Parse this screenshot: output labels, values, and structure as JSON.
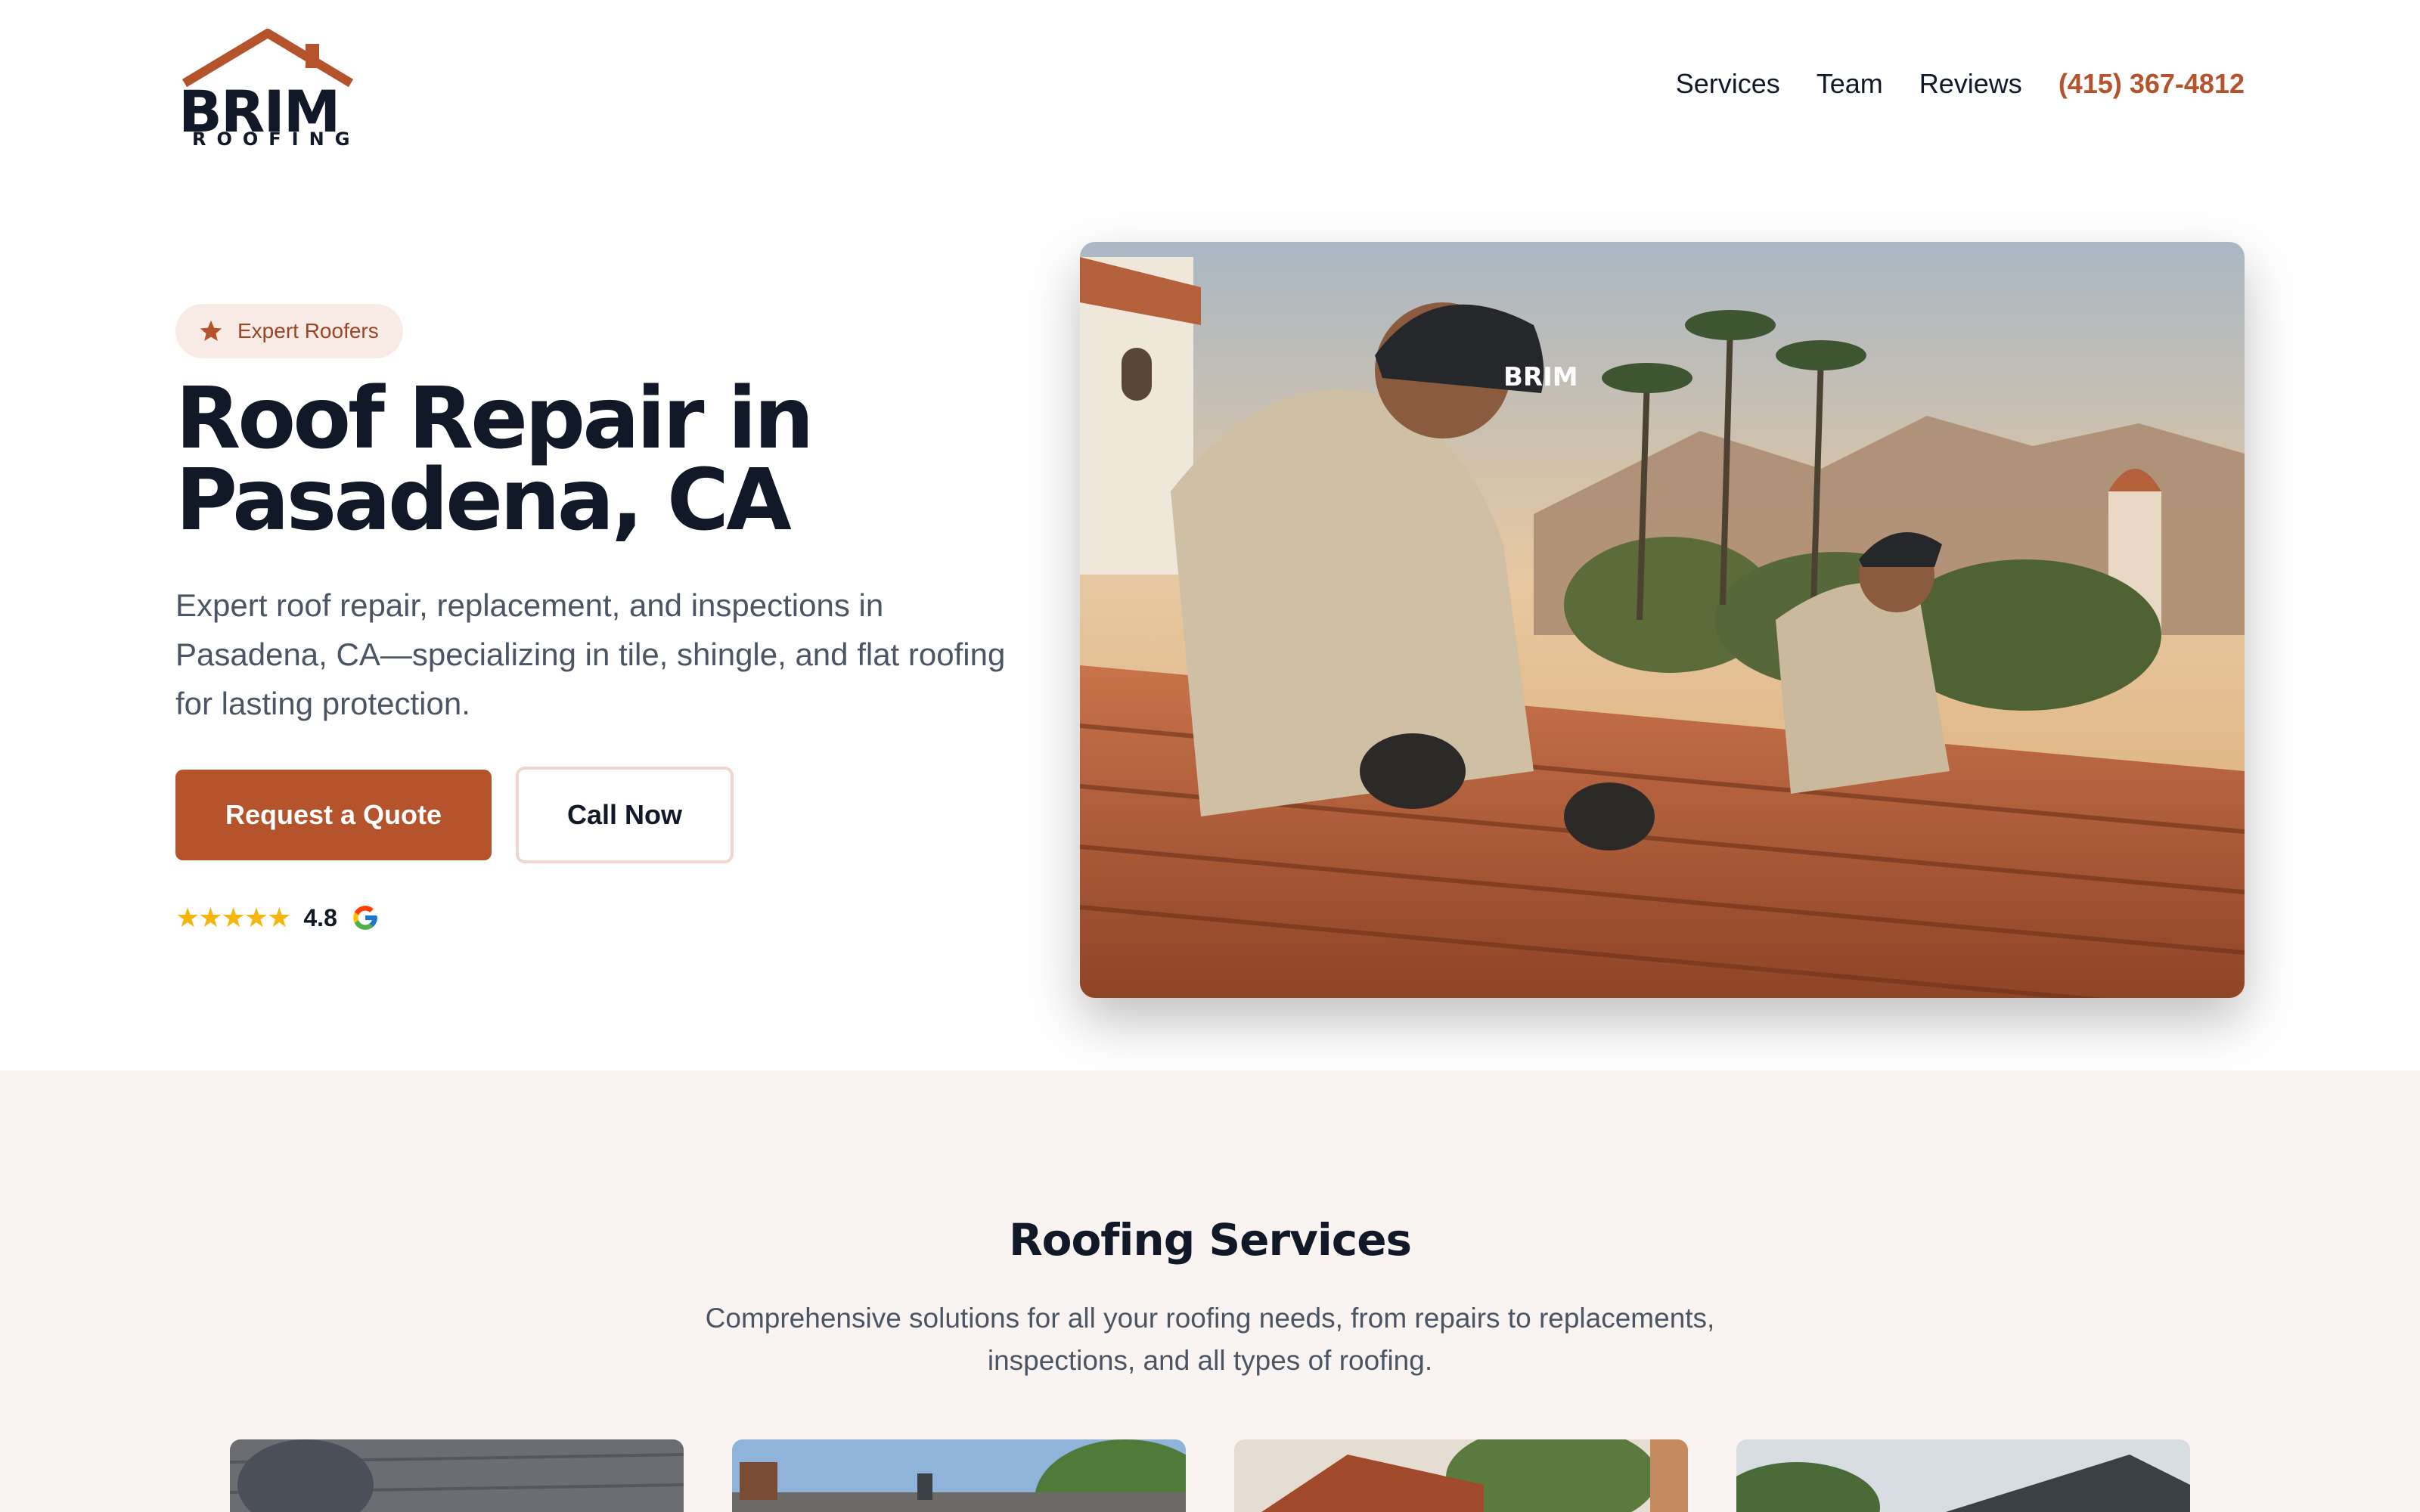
{
  "header": {
    "logo": {
      "brand": "BRIM",
      "sub": "ROOFING"
    },
    "nav": [
      {
        "label": "Services"
      },
      {
        "label": "Team"
      },
      {
        "label": "Reviews"
      }
    ],
    "phone": "(415) 367-4812"
  },
  "hero": {
    "badge": "Expert Roofers",
    "title_line1": "Roof Repair in",
    "title_line2": "Pasadena, CA",
    "description": "Expert roof repair, replacement, and inspections in Pasadena, CA—specializing in tile, shingle, and flat roofing for lasting protection.",
    "primary_cta": "Request a Quote",
    "secondary_cta": "Call Now",
    "rating": {
      "stars": "★★★★★",
      "value": "4.8"
    },
    "image_cap_text": "BRIM"
  },
  "services": {
    "title": "Roofing Services",
    "subtitle": "Comprehensive solutions for all your roofing needs, from repairs to replacements, inspections, and all types of roofing."
  },
  "colors": {
    "accent": "#b5532d",
    "badge_bg": "#f8ebe5",
    "section_bg": "#f9f3f1",
    "star": "#f5b50a"
  }
}
